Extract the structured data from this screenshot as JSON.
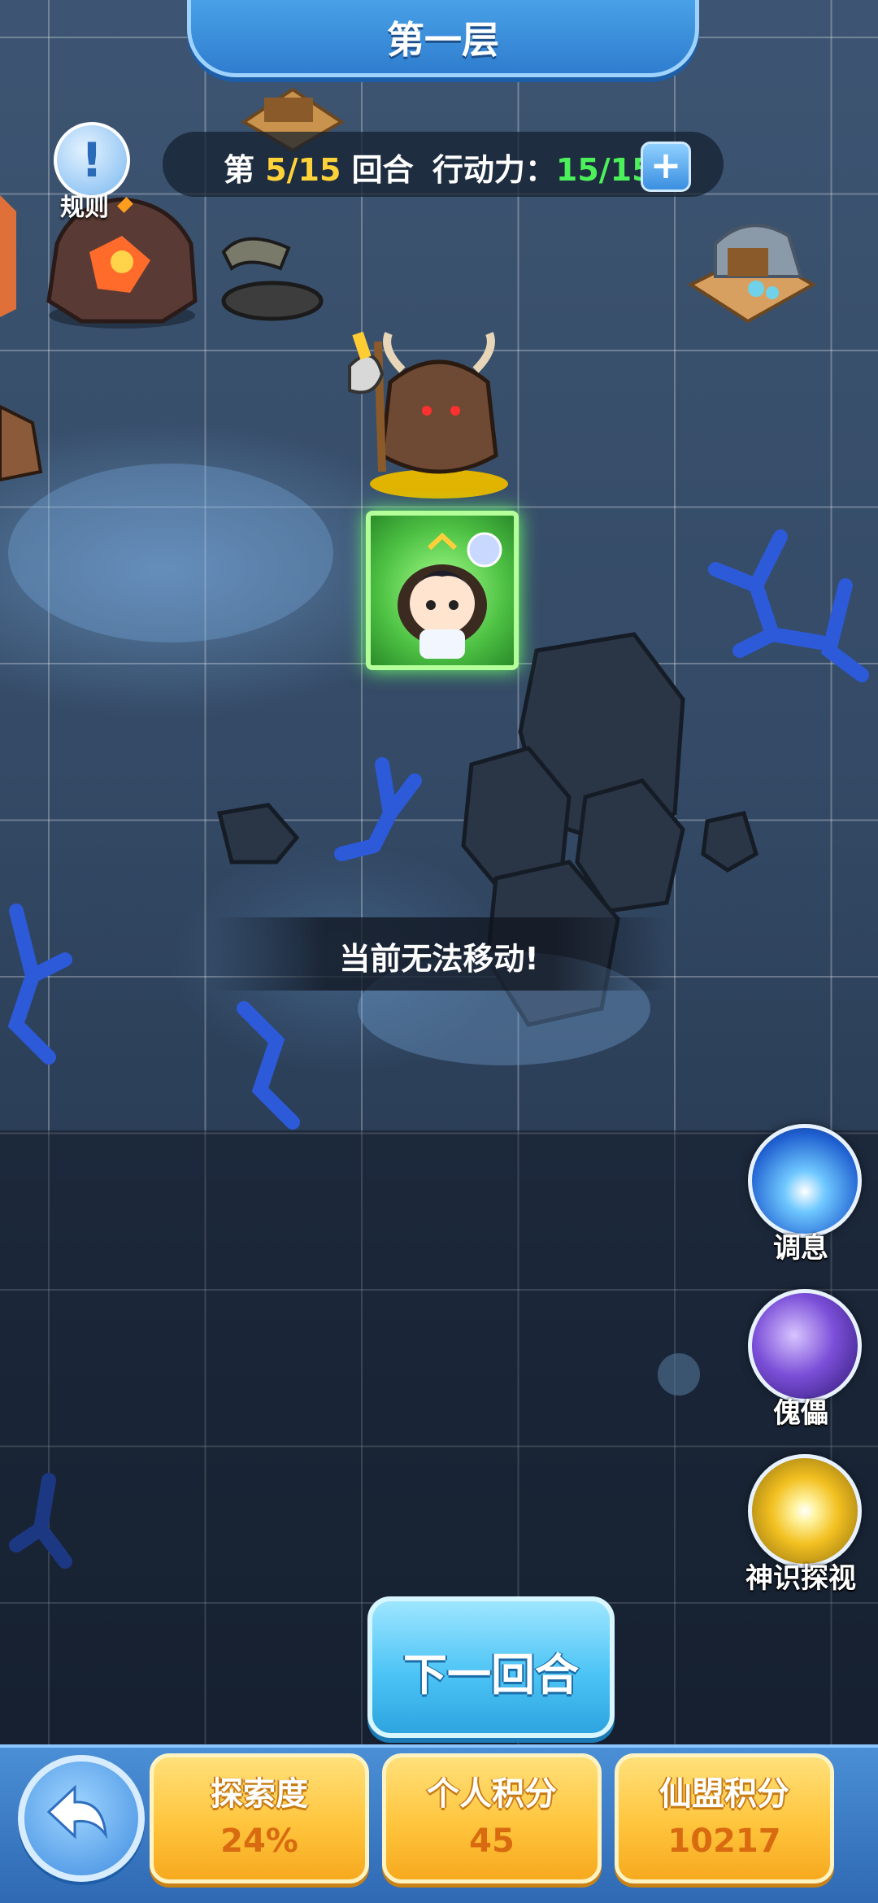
{
  "header": {
    "title": "第一层"
  },
  "status": {
    "round_prefix": "第 ",
    "round_current": "5/15",
    "round_suffix": " 回合",
    "action_label": "行动力：",
    "action_value": "15/15",
    "plus": "+"
  },
  "rules": {
    "label": "规则",
    "icon": "!"
  },
  "toast": {
    "message": "当前无法移动!"
  },
  "skills": [
    {
      "label": "调息",
      "icon": "meditation-icon"
    },
    {
      "label": "傀儡",
      "icon": "puppet-icon"
    },
    {
      "label": "神识探视",
      "icon": "eye-icon"
    }
  ],
  "next_round": {
    "label": "下一回合"
  },
  "stats": [
    {
      "label": "探索度",
      "value": "24%"
    },
    {
      "label": "个人积分",
      "value": "45"
    },
    {
      "label": "仙盟积分",
      "value": "10217"
    }
  ],
  "colors": {
    "accent_yellow": "#ffd23a",
    "accent_green": "#4cf05a",
    "button_blue": "#4cc4f5",
    "card_gold": "#ffc53d"
  }
}
